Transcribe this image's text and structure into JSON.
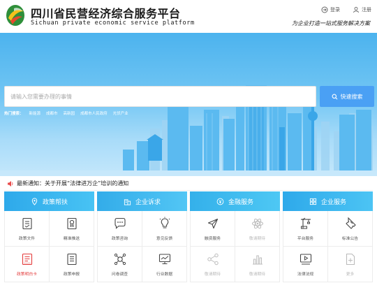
{
  "header": {
    "title": "四川省民营经济综合服务平台",
    "subtitle": "Sichuan private economic service platform",
    "login": "登录",
    "register": "注册",
    "slogan": "为企业打造一站式服务解决方案"
  },
  "search": {
    "placeholder": "请输入您需要办理的事情",
    "button": "快速搜索"
  },
  "hot_search": {
    "label": "热门搜索：",
    "items": [
      "新能源",
      "成都市",
      "高新园",
      "成都市人民政府",
      "光伏产业"
    ]
  },
  "notice": {
    "text": "最新通知：关于开展“法律进万企”培训的通知"
  },
  "categories": [
    {
      "title": "政策帮扶",
      "icon": "location-pin-icon",
      "tiles": [
        {
          "label": "政策文件",
          "icon": "policy-doc-icon"
        },
        {
          "label": "精准推送",
          "icon": "certificate-icon"
        },
        {
          "label": "政策明白卡",
          "icon": "policy-card-icon",
          "state": "active"
        },
        {
          "label": "政策申报",
          "icon": "declare-doc-icon"
        }
      ]
    },
    {
      "title": "企业诉求",
      "icon": "building-icon",
      "tiles": [
        {
          "label": "政策咨询",
          "icon": "chat-bubble-icon"
        },
        {
          "label": "意见反馈",
          "icon": "lightbulb-icon"
        },
        {
          "label": "问卷调查",
          "icon": "network-icon"
        },
        {
          "label": "行业数据",
          "icon": "monitor-icon"
        }
      ]
    },
    {
      "title": "金融服务",
      "icon": "coin-icon",
      "tiles": [
        {
          "label": "融资服务",
          "icon": "send-arrow-icon"
        },
        {
          "label": "敬请期待",
          "icon": "atom-icon",
          "state": "disabled"
        },
        {
          "label": "敬请期待",
          "icon": "share-icon",
          "state": "disabled"
        },
        {
          "label": "敬请期待",
          "icon": "bar-chart-icon",
          "state": "disabled"
        }
      ]
    },
    {
      "title": "企业服务",
      "icon": "grid-icon",
      "tiles": [
        {
          "label": "平台服务",
          "icon": "crane-icon"
        },
        {
          "label": "标准公告",
          "icon": "ticket-icon"
        },
        {
          "label": "法律法规",
          "icon": "video-icon"
        },
        {
          "label": "更多",
          "icon": "more-doc-icon",
          "state": "disabled"
        }
      ]
    }
  ],
  "colors": {
    "accent": "#4aa0f4",
    "header_bar": "#2ea9ea",
    "active_tile": "#e33b3b",
    "disabled_tile": "#bbbbbb"
  }
}
